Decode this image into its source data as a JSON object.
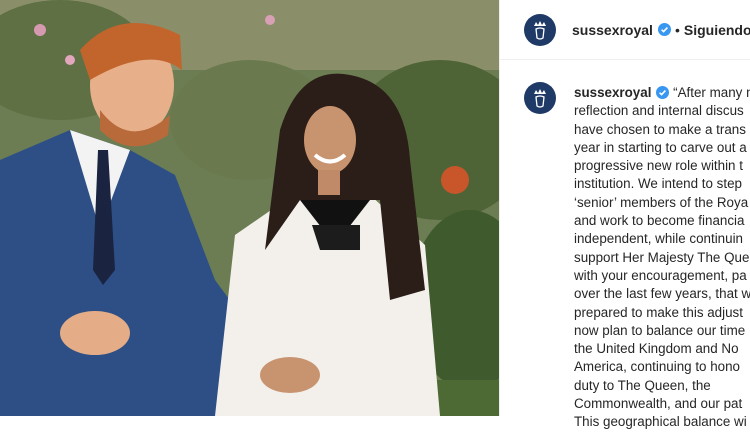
{
  "post": {
    "photo_alt": "",
    "username": "sussexroyal",
    "follow_separator": "•",
    "follow_status": "Siguiendo",
    "caption_lines": [
      "“After many m",
      "reflection and internal discus",
      "have chosen to make a trans",
      "year in starting to carve out a",
      "progressive new role within t",
      "institution. We intend to step",
      "‘senior’ members of the Roya",
      "and work to become financia",
      "independent, while continuin",
      "support Her Majesty The Que",
      "with your encouragement, pa",
      "over the last few years, that w",
      "prepared to make this adjust",
      "now plan to balance our time",
      "the United Kingdom and No",
      "America, continuing to hono",
      "duty to The Queen, the",
      "Commonwealth, and our pat",
      "This geographical balance wi"
    ]
  },
  "colors": {
    "avatar_bg": "#1f3a66",
    "verified": "#3897f0",
    "text": "#262626"
  },
  "icons": {
    "verified": "verified-badge-icon",
    "avatar": "royal-crest-icon"
  }
}
